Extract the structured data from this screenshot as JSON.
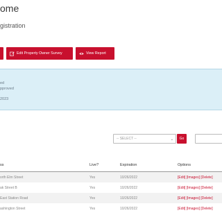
{
  "page": {
    "title": "ome",
    "subtitle": "gistration"
  },
  "toolbar": {
    "edit_survey_label": "Edit Property Owner Survey",
    "view_report_label": "View Report",
    "edit_icon": "edit-icon",
    "eye_icon": "eye-icon"
  },
  "info": {
    "line1": "ed",
    "line2": "pproved",
    "line3": "2023"
  },
  "filter": {
    "select_value": "-- SELECT --",
    "go_label": "Go",
    "search_value": ""
  },
  "table": {
    "columns": [
      "ss",
      "Live?",
      "Expiration",
      "Options"
    ],
    "rows": [
      {
        "address": "orth Elm Street",
        "live": "Yes",
        "expiration": "10/26/2022",
        "options": "[Edit] [Images] [Delete]"
      },
      {
        "address": "ak Street B",
        "live": "Yes",
        "expiration": "10/26/2022",
        "options": "[Edit] [Images] [Delete]"
      },
      {
        "address": "East Station Road",
        "live": "Yes",
        "expiration": "10/26/2022",
        "options": "[Edit] [Images] [Delete]"
      },
      {
        "address": "ashington Street",
        "live": "Yes",
        "expiration": "10/26/2022",
        "options": "[Edit] [Images] [Delete]"
      }
    ]
  },
  "colors": {
    "accent": "#c8102e",
    "info_bg": "#dbeff7"
  }
}
